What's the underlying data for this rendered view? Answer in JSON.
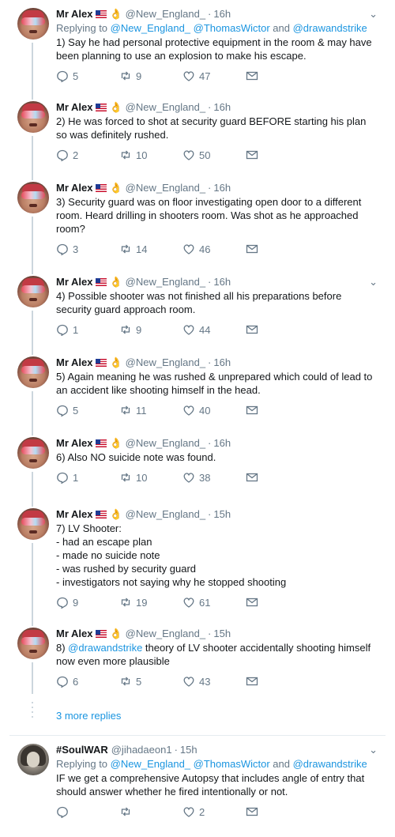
{
  "tweets": [
    {
      "name": "Mr Alex",
      "handle": "@New_England_",
      "dot": "·",
      "time": "16h",
      "replying": {
        "prefix": "Replying to ",
        "u1": "@New_England_",
        "u2": "@ThomasWictor",
        "and": " and ",
        "u3": "@drawandstrike"
      },
      "text": "1) Say he had personal protective equipment in the room & may have been planning to use an explosion to make his escape.",
      "replies": "5",
      "retweets": "9",
      "likes": "47"
    },
    {
      "name": "Mr Alex",
      "handle": "@New_England_",
      "dot": "·",
      "time": "16h",
      "text": "2) He was forced to shot at security guard BEFORE starting his plan so was definitely rushed.",
      "replies": "2",
      "retweets": "10",
      "likes": "50"
    },
    {
      "name": "Mr Alex",
      "handle": "@New_England_",
      "dot": "·",
      "time": "16h",
      "text": "3) Security guard was on floor investigating open door to a different room. Heard drilling in shooters room. Was shot as he approached room?",
      "replies": "3",
      "retweets": "14",
      "likes": "46"
    },
    {
      "name": "Mr Alex",
      "handle": "@New_England_",
      "dot": "·",
      "time": "16h",
      "text": "4) Possible shooter was not finished all his preparations before security guard approach room.",
      "replies": "1",
      "retweets": "9",
      "likes": "44"
    },
    {
      "name": "Mr Alex",
      "handle": "@New_England_",
      "dot": "·",
      "time": "16h",
      "text": "5) Again meaning he was rushed & unprepared which could of lead to an accident like shooting himself in the head.",
      "replies": "5",
      "retweets": "11",
      "likes": "40"
    },
    {
      "name": "Mr Alex",
      "handle": "@New_England_",
      "dot": "·",
      "time": "16h",
      "text": "6) Also NO suicide note was found.",
      "replies": "1",
      "retweets": "10",
      "likes": "38"
    },
    {
      "name": "Mr Alex",
      "handle": "@New_England_",
      "dot": "·",
      "time": "15h",
      "text": "7) LV Shooter:\n- had an escape plan\n- made no suicide note\n- was rushed by security guard\n- investigators not saying why he stopped shooting",
      "replies": "9",
      "retweets": "19",
      "likes": "61"
    },
    {
      "name": "Mr Alex",
      "handle": "@New_England_",
      "dot": "·",
      "time": "15h",
      "mention": "@drawandstrike",
      "text_after_mention": " theory of LV shooter accidentally shooting himself now even more plausible",
      "text_prefix": "8) ",
      "replies": "6",
      "retweets": "5",
      "likes": "43"
    }
  ],
  "more_replies": "3 more replies",
  "reply": {
    "name": "#SoulWAR",
    "handle": "@jihadaeon1",
    "dot": "·",
    "time": "15h",
    "replying": {
      "prefix": "Replying to ",
      "u1": "@New_England_",
      "u2": "@ThomasWictor",
      "and": " and ",
      "u3": "@drawandstrike"
    },
    "text": "IF we get a comprehensive Autopsy that includes angle of entry that should answer whether he fired intentionally or not.",
    "replies": "",
    "retweets": "",
    "likes": "2"
  },
  "icons": {
    "reply": "reply-icon",
    "retweet": "retweet-icon",
    "like": "heart-icon",
    "dm": "envelope-icon",
    "caret": "chevron-down-icon"
  },
  "colors": {
    "link": "#1b95e0",
    "muted": "#657786",
    "thread_line": "#ccd6dd"
  }
}
